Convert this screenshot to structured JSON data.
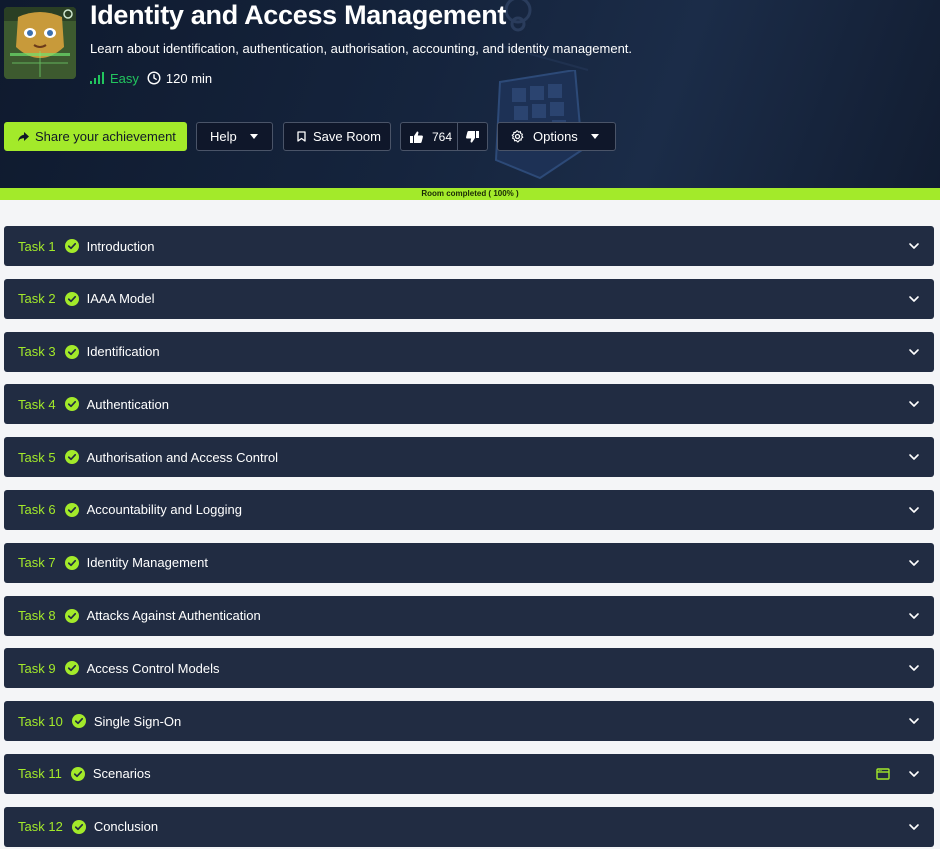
{
  "room": {
    "title": "Identity and Access Management",
    "subtitle": "Learn about identification, authentication, authorisation, accounting, and identity management.",
    "difficulty": "Easy",
    "duration": "120 min",
    "icon": "room-logo-face-icon"
  },
  "toolbar": {
    "share_label": "Share your achievement",
    "help_label": "Help",
    "save_label": "Save Room",
    "upvotes": "764",
    "options_label": "Options"
  },
  "progress": {
    "label": "Room completed ( 100% )",
    "percent": 100
  },
  "colors": {
    "accent": "#a3ea2a",
    "easy": "#22c55e",
    "task_bg": "#212c42",
    "hero_bg": "#15243d"
  },
  "tasks": [
    {
      "num": "Task 1",
      "title": "Introduction",
      "completed": true
    },
    {
      "num": "Task 2",
      "title": "IAAA Model",
      "completed": true
    },
    {
      "num": "Task 3",
      "title": "Identification",
      "completed": true
    },
    {
      "num": "Task 4",
      "title": "Authentication",
      "completed": true
    },
    {
      "num": "Task 5",
      "title": "Authorisation and Access Control",
      "completed": true
    },
    {
      "num": "Task 6",
      "title": "Accountability and Logging",
      "completed": true
    },
    {
      "num": "Task 7",
      "title": "Identity Management",
      "completed": true
    },
    {
      "num": "Task 8",
      "title": "Attacks Against Authentication",
      "completed": true
    },
    {
      "num": "Task 9",
      "title": "Access Control Models",
      "completed": true
    },
    {
      "num": "Task 10",
      "title": "Single Sign-On",
      "completed": true
    },
    {
      "num": "Task 11",
      "title": "Scenarios",
      "completed": true,
      "extra_icon": "static-site-icon"
    },
    {
      "num": "Task 12",
      "title": "Conclusion",
      "completed": true
    }
  ]
}
